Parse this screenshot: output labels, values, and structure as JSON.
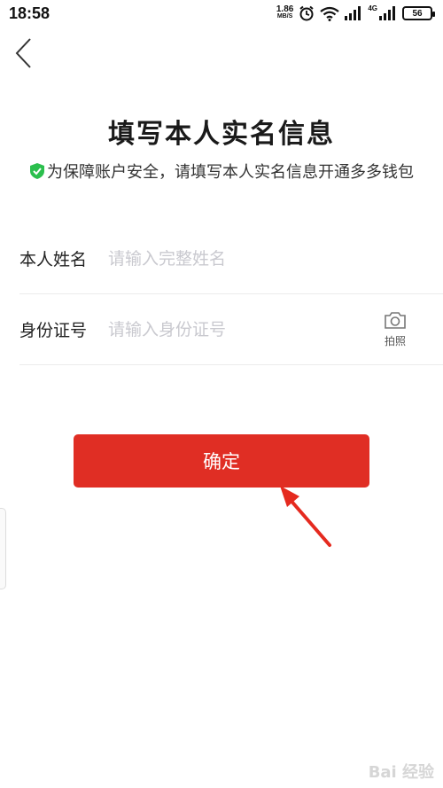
{
  "status_bar": {
    "time": "18:58",
    "net_speed_value": "1.86",
    "net_speed_unit": "MB/S",
    "network_type": "4G",
    "battery": "56"
  },
  "page": {
    "title": "填写本人实名信息",
    "subtitle": "为保障账户安全，请填写本人实名信息开通多多钱包"
  },
  "form": {
    "name_label": "本人姓名",
    "name_placeholder": "请输入完整姓名",
    "name_value": "",
    "id_label": "身份证号",
    "id_placeholder": "请输入身份证号",
    "id_value": "",
    "camera_label": "拍照"
  },
  "confirm_label": "确定",
  "watermark": "Bai 经验",
  "colors": {
    "primary": "#e02e24",
    "shield": "#2bbf4d",
    "placeholder": "#c9c9cf"
  },
  "icons": [
    "back-icon",
    "shield-check-icon",
    "camera-icon",
    "alarm-icon",
    "wifi-icon",
    "signal-icon",
    "annotation-arrow"
  ]
}
